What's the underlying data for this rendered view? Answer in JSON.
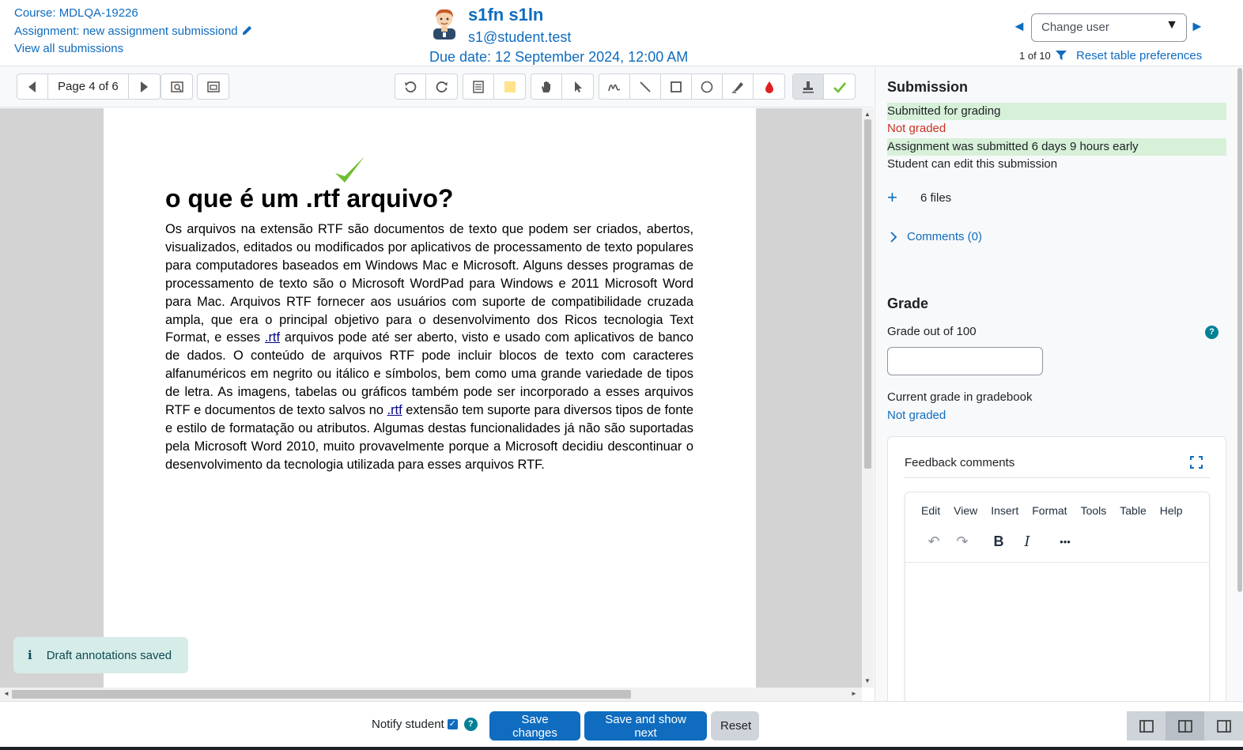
{
  "header": {
    "course": "Course: MDLQA-19226",
    "assignment": "Assignment: new assignment submissiond",
    "view_all": "View all submissions",
    "user_name": "s1fn s1ln",
    "user_email": "s1@student.test",
    "due_date": "Due date: 12 September 2024, 12:00 AM",
    "change_user_placeholder": "Change user",
    "counter": "1 of 10",
    "reset_table": "Reset table preferences"
  },
  "toolbar": {
    "page_label": "Page 4 of 6",
    "icons": [
      "previous-page-icon",
      "next-page-icon",
      "search-comments-icon",
      "expand-comments-icon",
      "rotate-left-icon",
      "rotate-right-icon",
      "comment-icon",
      "comment-color-icon",
      "pan-icon",
      "select-icon",
      "pen-icon",
      "line-icon",
      "rectangle-icon",
      "oval-icon",
      "highlighter-icon",
      "annotation-color-icon",
      "stamp-icon",
      "stamp-check-icon"
    ]
  },
  "document": {
    "heading": "o que é um .rtf arquivo?",
    "paragraph_part1": "Os arquivos na extensão RTF são documentos de texto que podem ser criados, abertos, visualizados, editados ou modificados por aplicativos de processamento de texto populares para computadores baseados em Windows Mac e Microsoft. Alguns desses programas de processamento de texto são o Microsoft WordPad para Windows e 2011 Microsoft Word para Mac. Arquivos RTF fornecer aos usuários com suporte de compatibilidade cruzada ampla, que era o principal objetivo para o desenvolvimento dos Ricos tecnologia Text Format, e esses ",
    "link1": ".rtf",
    "paragraph_part2": " arquivos pode até ser aberto, visto e usado com aplicativos de banco de dados. O conteúdo de arquivos RTF pode incluir blocos de texto com caracteres alfanuméricos em negrito ou itálico e símbolos, bem como uma grande variedade de tipos de letra. As imagens, tabelas ou gráficos também pode ser incorporado a esses arquivos RTF e documentos de texto salvos no ",
    "link2": ".rtf",
    "paragraph_part3": " extensão tem suporte para diversos tipos de fonte e estilo de formatação ou atributos. Algumas destas funcionalidades já não são suportadas pela Microsoft Word 2010, muito provavelmente porque a Microsoft decidiu descontinuar o desenvolvimento da tecnologia utilizada para esses arquivos RTF."
  },
  "toast": {
    "icon": "i",
    "text": "Draft annotations saved"
  },
  "panel": {
    "submission_title": "Submission",
    "status_submitted": "Submitted for grading",
    "status_grading": "Not graded",
    "status_early": "Assignment was submitted 6 days 9 hours early",
    "status_edit": "Student can edit this submission",
    "files": "6 files",
    "comments": "Comments (0)",
    "grade_title": "Grade",
    "grade_out_of": "Grade out of 100",
    "current_grade_label": "Current grade in gradebook",
    "current_grade_value": "Not graded",
    "feedback_title": "Feedback comments",
    "editor_menu": [
      "Edit",
      "View",
      "Insert",
      "Format",
      "Tools",
      "Table",
      "Help"
    ],
    "editor_tools": {
      "bold": "B",
      "italic": "I",
      "more": "•••"
    }
  },
  "footer": {
    "notify_label": "Notify student",
    "notify_checked": true,
    "save_changes": "Save changes",
    "save_next": "Save and show next",
    "reset": "Reset",
    "layout_buttons": [
      "collapse-grade-panel-icon",
      "default-layout-icon",
      "collapse-review-panel-icon"
    ]
  },
  "colors": {
    "link": "#0f6cbf",
    "primary": "#0f6cbf",
    "status_green": "#d7f1d9",
    "status_red": "#ca3120",
    "check_green": "#6fbe2e"
  }
}
